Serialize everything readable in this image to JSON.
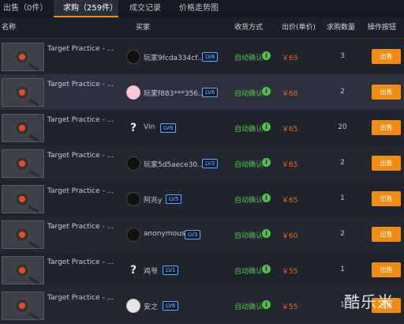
{
  "tabs": [
    {
      "label": "出售（0件）"
    },
    {
      "label": "求购（259件）"
    },
    {
      "label": "成交记录"
    },
    {
      "label": "价格走势图"
    }
  ],
  "header": {
    "name": "名称",
    "buyer": "买家",
    "receive": "收货方式",
    "price": "出价(单价)",
    "qty": "求购数量",
    "action": "操作按钮"
  },
  "rows": [
    {
      "item": "Target Practice - ...",
      "buyer": "玩家9fcda334cf...",
      "level": "LV8",
      "receive": "自动确认",
      "price": "￥69",
      "qty": "3",
      "button": "出售"
    },
    {
      "item": "Target Practice - ...",
      "buyer": "玩家f883***356...",
      "level": "LV6",
      "receive": "自动确认",
      "price": "￥68",
      "qty": "2",
      "button": "出售"
    },
    {
      "item": "Target Practice - ...",
      "buyer": "Vin",
      "level": "LV8",
      "receive": "自动确认",
      "price": "￥65",
      "qty": "20",
      "button": "出售"
    },
    {
      "item": "Target Practice - ...",
      "buyer": "玩家5d5aece30...",
      "level": "LV3",
      "receive": "自动确认",
      "price": "￥65",
      "qty": "2",
      "button": "出售"
    },
    {
      "item": "Target Practice - ...",
      "buyer": "阿兆y",
      "level": "LV5",
      "receive": "自动确认",
      "price": "￥65",
      "qty": "1",
      "button": "出售"
    },
    {
      "item": "Target Practice - ...",
      "buyer": "anonymous",
      "level": "LV3",
      "receive": "自动确认",
      "price": "￥60",
      "qty": "2",
      "button": "出售"
    },
    {
      "item": "Target Practice - ...",
      "buyer": "鸡爷",
      "level": "LV1",
      "receive": "自动确认",
      "price": "￥55",
      "qty": "1",
      "button": "出售"
    },
    {
      "item": "Target Practice - ...",
      "buyer": "安之",
      "level": "LV6",
      "receive": "自动确认",
      "price": "￥55",
      "qty": "1",
      "button": "出售"
    }
  ],
  "watermark": "酷乐米",
  "colors": {
    "accent": "#f08c13",
    "price": "#e36b2a",
    "receive": "#55c14d",
    "level_badge": "#63a7ff"
  }
}
